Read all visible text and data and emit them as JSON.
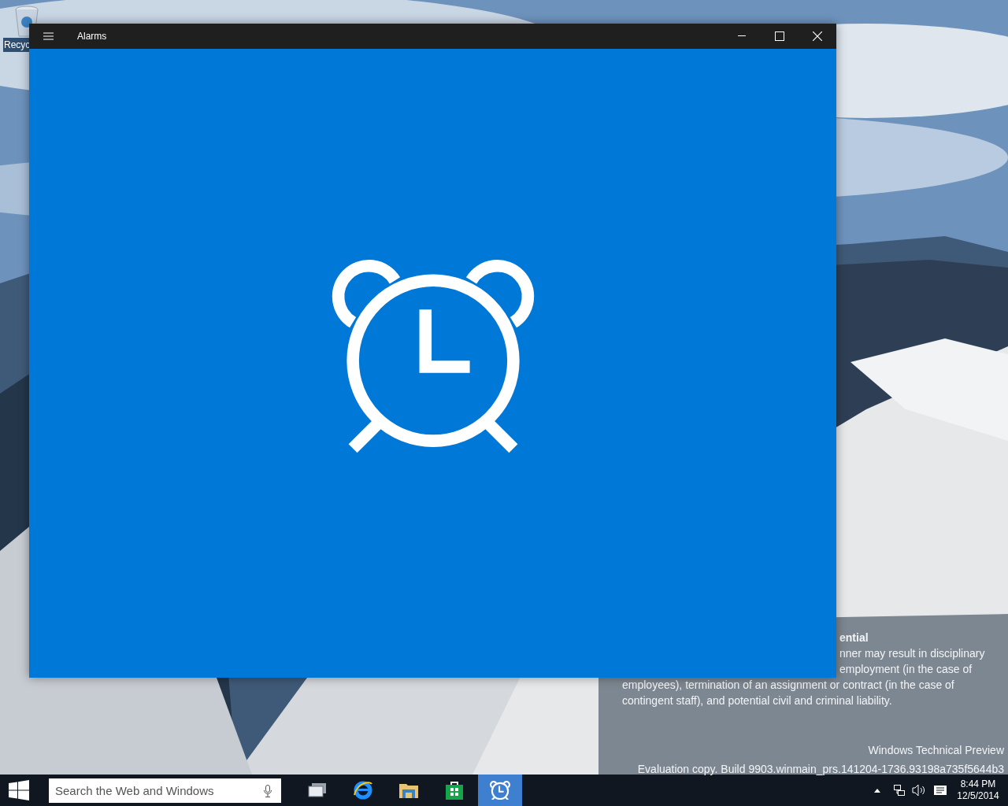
{
  "desktop": {
    "icons": [
      {
        "label": "Recyc"
      }
    ],
    "notice": {
      "heading": "ential",
      "lines": [
        "nner may result in disciplinary",
        "employment (in the case of",
        "employees), termination of an assignment or contract (in the case of",
        "contingent staff), and potential civil and criminal liability."
      ]
    },
    "build": [
      "Windows Technical Preview",
      "Evaluation copy. Build 9903.winmain_prs.141204-1736.93198a735f5644b3"
    ]
  },
  "window": {
    "title": "Alarms"
  },
  "taskbar": {
    "search": {
      "placeholder": "Search the Web and Windows"
    },
    "apps": [
      {
        "kind": "task-view",
        "selected": false
      },
      {
        "kind": "browser",
        "selected": false
      },
      {
        "kind": "explorer",
        "selected": false
      },
      {
        "kind": "store",
        "selected": false
      },
      {
        "kind": "alarms",
        "selected": true
      }
    ],
    "clock": {
      "time": "8:44 PM",
      "date": "12/5/2014"
    }
  }
}
